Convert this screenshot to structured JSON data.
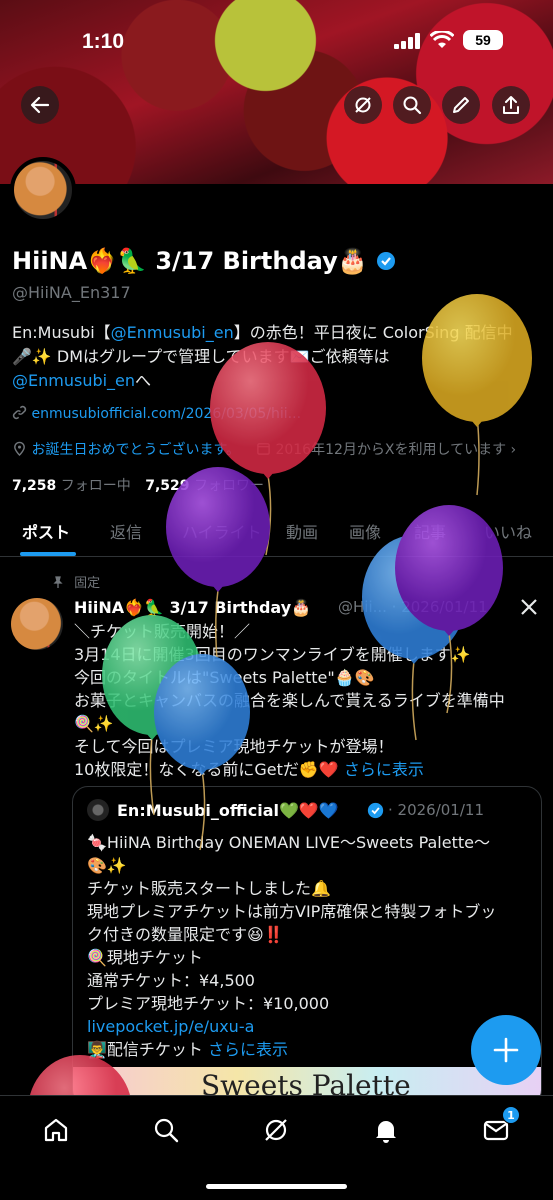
{
  "status": {
    "time": "1:10",
    "battery": "59"
  },
  "profile": {
    "name": "HiiNA❤️‍🔥🦜 3/17 Birthday🎂",
    "handle": "@HiiNA_En317",
    "bio_line1_pre": "En:Musubi【",
    "bio_mention1": "@Enmusubi_en",
    "bio_line1_post": "】の赤色！平日夜に ColorSing 配信中",
    "bio_line2": "🎤✨ DMはグループで管理しています✉️ご依頼等は",
    "bio_mention2": "@Enmusubi_en",
    "bio_line3_post": "へ",
    "website": "enmusubiofficial.com/2026/03/05/hii...",
    "birthday_text": "お誕生日おめでとうございます。",
    "joined": "2016年12月からXを利用しています",
    "following_count": "7,258",
    "following_label": "フォロー中",
    "followers_count": "7,529",
    "followers_label": "フォロワー"
  },
  "tabs": [
    "ポスト",
    "返信",
    "ハイライト",
    "動画",
    "画像",
    "記事",
    "いいね"
  ],
  "pinned": {
    "label": "固定",
    "author": "HiiNA❤️‍🔥🦜 3/17 Birthday🎂",
    "handle_date": "@Hii... · 2026/01/11",
    "lines": [
      "＼チケット販売開始！／",
      "3月14日に開催3回目のワンマンライブを開催します✨",
      "今回のタイトルは\"Sweets Palette\"🧁🎨",
      "お菓子とキャンバスの融合を楽しんで貰えるライブを準備中",
      "🍭✨",
      "そして今回はプレミア現地チケットが登場！"
    ],
    "last_line": "10枚限定！なくなる前にGetだ✊❤️",
    "show_more": "さらに表示"
  },
  "quote": {
    "author": "En:Musubi_official💚❤️💙",
    "date": "· 2026/01/11",
    "lines": [
      "🍬HiiNA Birthday ONEMAN LIVE〜Sweets Palette〜",
      "🎨✨",
      "チケット販売スタートしました🔔",
      "現地プレミアチケットは前方VIP席確保と特製フォトブッ",
      "ク付きの数量限定です😆‼️",
      "🍭現地チケット",
      "通常チケット：¥4,500",
      "プレミア現地チケット：¥10,000"
    ],
    "link": "livepocket.jp/e/uxu-a",
    "last_line": "👨‍🏫配信チケット",
    "show_more": "さらに表示",
    "image_text": "Sweets Palette"
  },
  "nav": {
    "messages_badge": "1"
  }
}
